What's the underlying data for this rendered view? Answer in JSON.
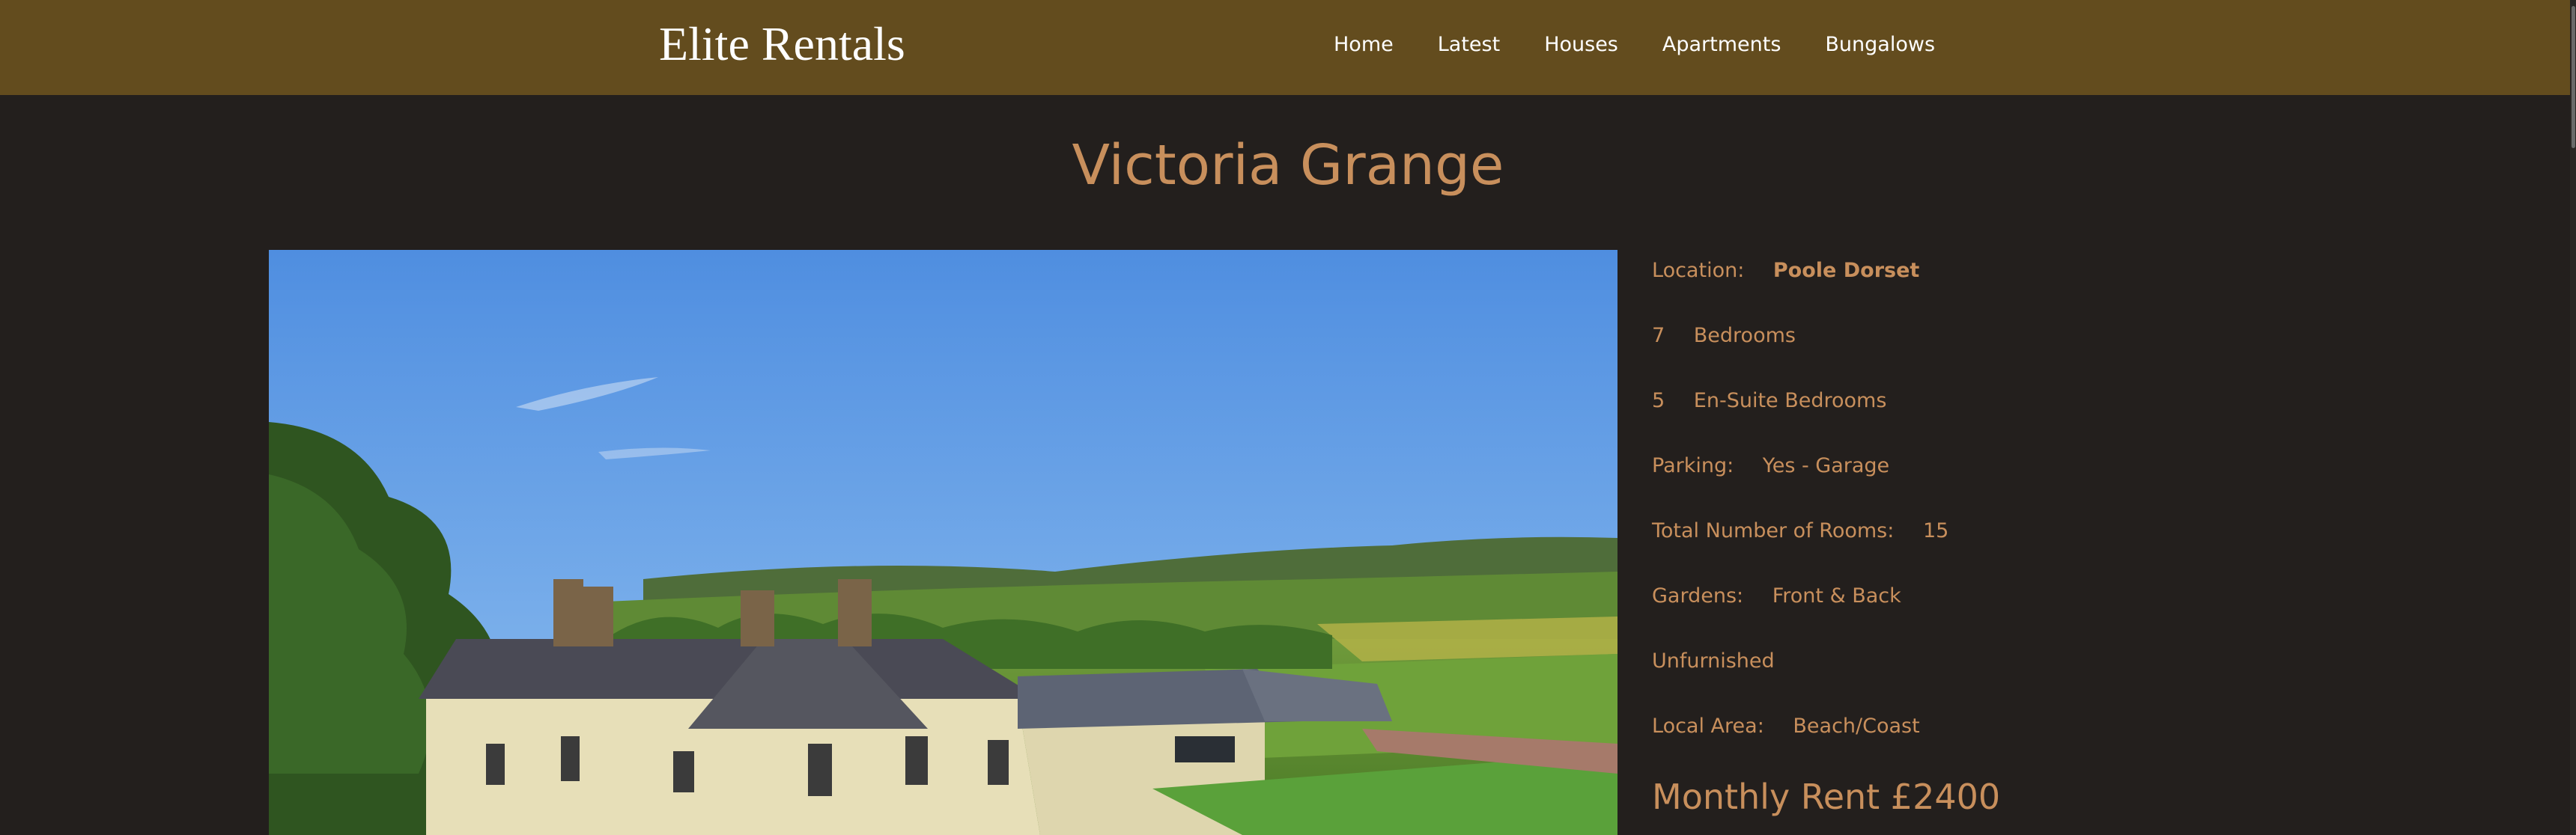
{
  "header": {
    "brand": "Elite Rentals",
    "nav": [
      "Home",
      "Latest",
      "Houses",
      "Apartments",
      "Bungalows"
    ]
  },
  "property": {
    "title": "Victoria Grange",
    "location_label": "Location:",
    "location_value": "Poole Dorset",
    "bedrooms_count": "7",
    "bedrooms_label": "Bedrooms",
    "ensuite_count": "5",
    "ensuite_label": "En-Suite Bedrooms",
    "parking_label": "Parking:",
    "parking_value": "Yes - Garage",
    "rooms_label": "Total Number of Rooms:",
    "rooms_value": "15",
    "gardens_label": "Gardens:",
    "gardens_value": "Front & Back",
    "furnishing": "Unfurnished",
    "area_label": "Local Area:",
    "area_value": "Beach/Coast",
    "rent": "Monthly Rent £2400"
  },
  "colors": {
    "header_bg": "#634c1e",
    "page_bg": "#231f1d",
    "accent": "#c88f5c"
  }
}
